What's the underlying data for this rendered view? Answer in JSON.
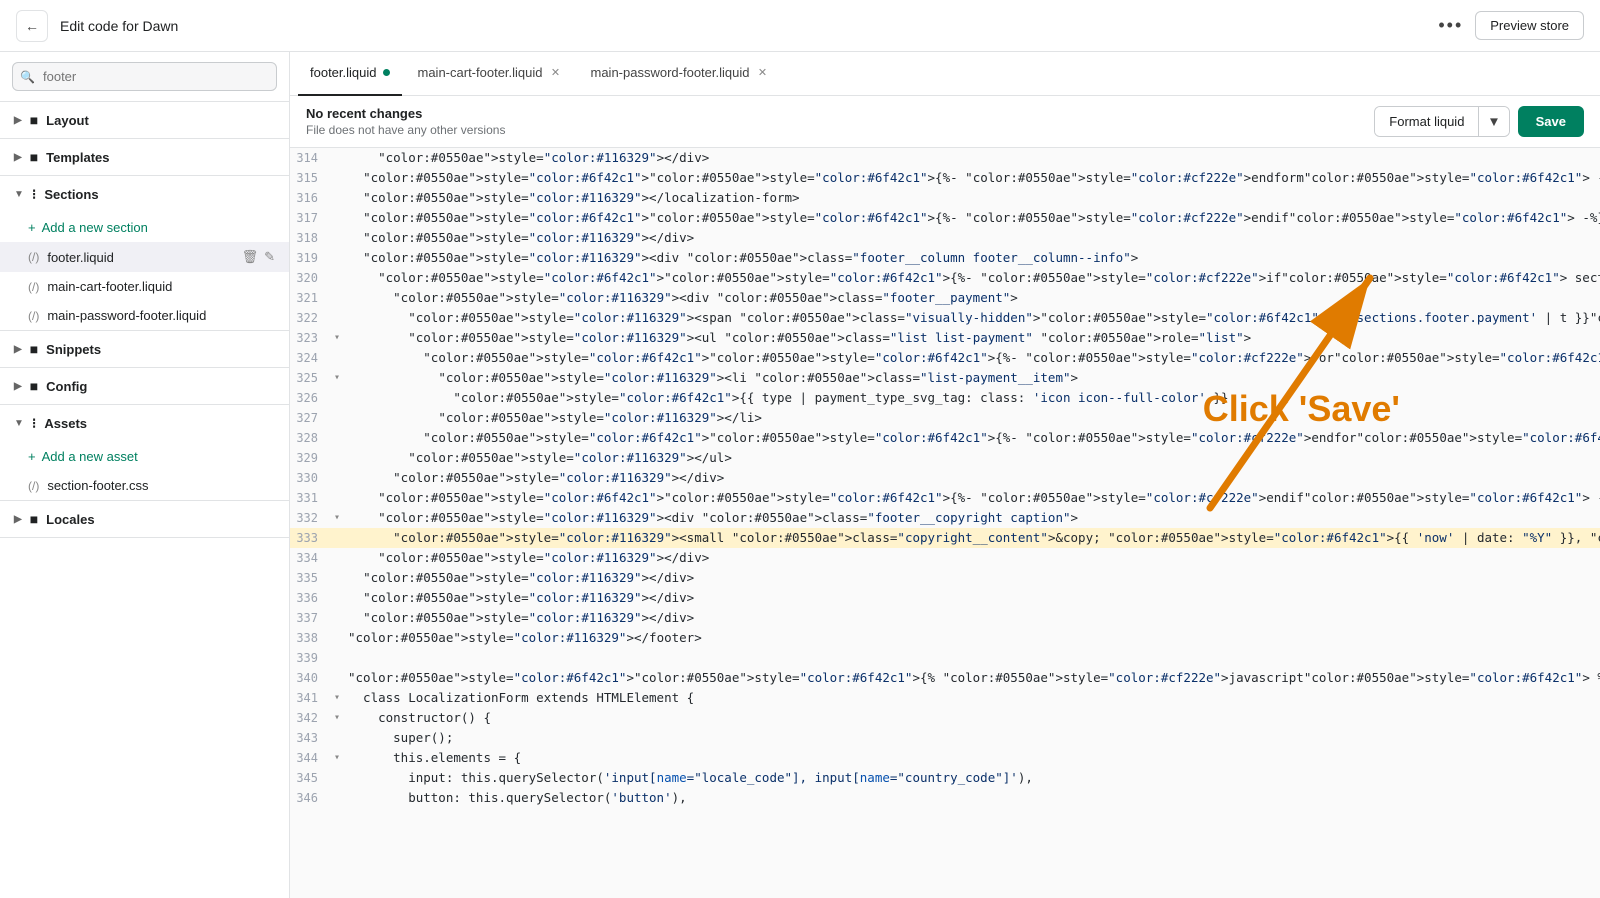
{
  "topbar": {
    "title": "Edit code for Dawn",
    "dots_label": "•••",
    "preview_label": "Preview store"
  },
  "search": {
    "placeholder": "footer",
    "value": "footer"
  },
  "sidebar": {
    "layout_label": "Layout",
    "templates_label": "Templates",
    "sections_label": "Sections",
    "sections_items": [
      {
        "label": "Add a new section",
        "type": "add"
      },
      {
        "label": "footer.liquid",
        "active": true
      },
      {
        "label": "main-cart-footer.liquid"
      },
      {
        "label": "main-password-footer.liquid"
      }
    ],
    "snippets_label": "Snippets",
    "config_label": "Config",
    "assets_label": "Assets",
    "assets_add_label": "Add a new asset",
    "assets_items": [
      {
        "label": "section-footer.css"
      }
    ],
    "locales_label": "Locales"
  },
  "tabs": [
    {
      "label": "footer.liquid",
      "active": true,
      "modified": true,
      "closeable": false
    },
    {
      "label": "main-cart-footer.liquid",
      "active": false,
      "modified": false,
      "closeable": true
    },
    {
      "label": "main-password-footer.liquid",
      "active": false,
      "modified": false,
      "closeable": true
    }
  ],
  "editor_header": {
    "status": "No recent changes",
    "description": "File does not have any other versions",
    "format_label": "Format liquid",
    "save_label": "Save"
  },
  "annotation": {
    "click_save": "Click 'Save'"
  },
  "code_lines": [
    {
      "num": 314,
      "indent": 3,
      "code": "    </div>",
      "arrow": false,
      "highlighted": false
    },
    {
      "num": 315,
      "indent": 2,
      "code": "  {%- endform -%}",
      "arrow": false,
      "highlighted": false
    },
    {
      "num": 316,
      "indent": 2,
      "code": "  </localization-form>",
      "arrow": false,
      "highlighted": false
    },
    {
      "num": 317,
      "indent": 2,
      "code": "  {%- endif -%}",
      "arrow": false,
      "highlighted": false
    },
    {
      "num": 318,
      "indent": 2,
      "code": "  </div>",
      "arrow": false,
      "highlighted": false
    },
    {
      "num": 319,
      "indent": 2,
      "code": "  <div class=\"footer__column footer__column--info\">",
      "arrow": false,
      "highlighted": false
    },
    {
      "num": 320,
      "indent": 3,
      "code": "    {%- if section.settings.payment_enable -%}",
      "arrow": false,
      "highlighted": false
    },
    {
      "num": 321,
      "indent": 3,
      "code": "      <div class=\"footer__payment\">",
      "arrow": false,
      "highlighted": false
    },
    {
      "num": 322,
      "indent": 4,
      "code": "        <span class=\"visually-hidden\">{{ 'sections.footer.payment' | t }}</span>",
      "arrow": false,
      "highlighted": false
    },
    {
      "num": 323,
      "indent": 4,
      "code": "        <ul class=\"list list-payment\" role=\"list\">",
      "arrow": true,
      "highlighted": false
    },
    {
      "num": 324,
      "indent": 4,
      "code": "          {%- for type in shop.enabled_payment_types -%}",
      "arrow": false,
      "highlighted": false
    },
    {
      "num": 325,
      "indent": 5,
      "code": "            <li class=\"list-payment__item\">",
      "arrow": true,
      "highlighted": false
    },
    {
      "num": 326,
      "indent": 5,
      "code": "              {{ type | payment_type_svg_tag: class: 'icon icon--full-color' }}",
      "arrow": false,
      "highlighted": false
    },
    {
      "num": 327,
      "indent": 5,
      "code": "            </li>",
      "arrow": false,
      "highlighted": false
    },
    {
      "num": 328,
      "indent": 4,
      "code": "          {%- endfor -%}",
      "arrow": false,
      "highlighted": false
    },
    {
      "num": 329,
      "indent": 4,
      "code": "        </ul>",
      "arrow": false,
      "highlighted": false
    },
    {
      "num": 330,
      "indent": 3,
      "code": "      </div>",
      "arrow": false,
      "highlighted": false
    },
    {
      "num": 331,
      "indent": 3,
      "code": "    {%- endif -%}",
      "arrow": false,
      "highlighted": false
    },
    {
      "num": 332,
      "indent": 2,
      "code": "    <div class=\"footer__copyright caption\">",
      "arrow": true,
      "highlighted": false
    },
    {
      "num": 333,
      "indent": 3,
      "code": "      <small class=\"copyright__content\">&copy; {{ 'now' | date: \"%Y\" }}, {{ shop.name | link_to: routes.root_url }}</small>",
      "arrow": false,
      "highlighted": true
    },
    {
      "num": 334,
      "indent": 3,
      "code": "    </div>",
      "arrow": false,
      "highlighted": false
    },
    {
      "num": 335,
      "indent": 2,
      "code": "  </div>",
      "arrow": false,
      "highlighted": false
    },
    {
      "num": 336,
      "indent": 2,
      "code": "  </div>",
      "arrow": false,
      "highlighted": false
    },
    {
      "num": 337,
      "indent": 1,
      "code": "  </div>",
      "arrow": false,
      "highlighted": false
    },
    {
      "num": 338,
      "indent": 0,
      "code": "</footer>",
      "arrow": false,
      "highlighted": false
    },
    {
      "num": 339,
      "indent": 0,
      "code": "",
      "arrow": false,
      "highlighted": false
    },
    {
      "num": 340,
      "indent": 0,
      "code": "{% javascript %}",
      "arrow": false,
      "highlighted": false
    },
    {
      "num": 341,
      "indent": 0,
      "code": "  class LocalizationForm extends HTMLElement {",
      "arrow": true,
      "highlighted": false
    },
    {
      "num": 342,
      "indent": 1,
      "code": "    constructor() {",
      "arrow": true,
      "highlighted": false
    },
    {
      "num": 343,
      "indent": 2,
      "code": "      super();",
      "arrow": false,
      "highlighted": false
    },
    {
      "num": 344,
      "indent": 2,
      "code": "      this.elements = {",
      "arrow": true,
      "highlighted": false
    },
    {
      "num": 345,
      "indent": 3,
      "code": "        input: this.querySelector('input[name=\"locale_code\"], input[name=\"country_code\"]'),",
      "arrow": false,
      "highlighted": false
    },
    {
      "num": 346,
      "indent": 3,
      "code": "        button: this.querySelector('button'),",
      "arrow": false,
      "highlighted": false
    }
  ]
}
